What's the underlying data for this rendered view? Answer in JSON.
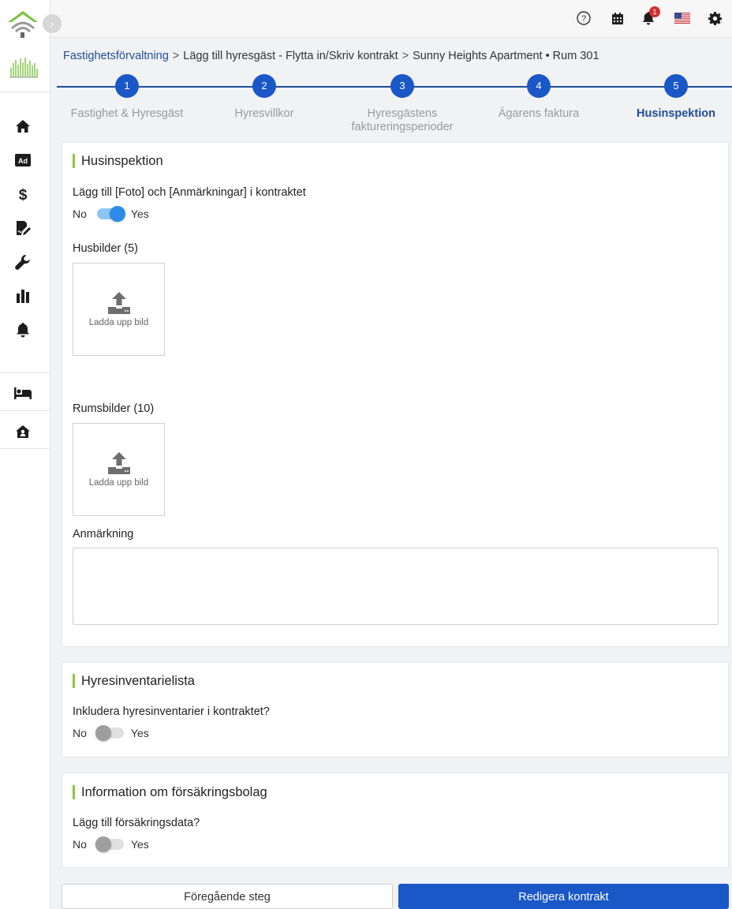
{
  "breadcrumb": {
    "root": "Fastighetsförvaltning",
    "separator": ">",
    "step": "Lägg till hyresgäst - Flytta in/Skriv kontrakt",
    "location": "Sunny Heights Apartment • Rum 301"
  },
  "topbar": {
    "help_icon": "help-circle-icon",
    "calendar_icon": "calendar-icon",
    "notification_icon": "bell-icon",
    "notification_count": "1",
    "language_icon": "us-flag-icon",
    "settings_icon": "gear-icon"
  },
  "sidebar": {
    "items": [
      {
        "icon": "home-icon"
      },
      {
        "icon": "ad-icon",
        "text": "Ad"
      },
      {
        "icon": "dollar-icon",
        "text": "$"
      },
      {
        "icon": "contract-sign-icon"
      },
      {
        "icon": "wrench-icon"
      },
      {
        "icon": "bar-chart-icon"
      },
      {
        "icon": "bell-icon"
      },
      {
        "icon": "bed-icon"
      },
      {
        "icon": "house-user-icon"
      }
    ]
  },
  "stepper": {
    "steps": [
      {
        "number": "1",
        "label": "Fastighet & Hyresgäst"
      },
      {
        "number": "2",
        "label": "Hyresvillkor"
      },
      {
        "number": "3",
        "label": "Hyresgästens faktureringsperioder"
      },
      {
        "number": "4",
        "label": "Ägarens faktura"
      },
      {
        "number": "5",
        "label": "Husinspektion"
      }
    ],
    "active_index": 4
  },
  "inspection": {
    "title": "Husinspektion",
    "question": "Lägg till [Foto] och [Anmärkningar] i kontraktet",
    "toggle_no": "No",
    "toggle_yes": "Yes",
    "toggle_on": true,
    "house_images_label": "Husbilder (5)",
    "room_images_label": "Rumsbilder (10)",
    "upload_text": "Ladda upp bild",
    "remark_label": "Anmärkning",
    "remark_value": ""
  },
  "inventory": {
    "title": "Hyresinventarielista",
    "question": "Inkludera hyresinventarier i kontraktet?",
    "toggle_no": "No",
    "toggle_yes": "Yes",
    "toggle_on": false
  },
  "insurance": {
    "title": "Information om försäkringsbolag",
    "question": "Lägg till försäkringsdata?",
    "toggle_no": "No",
    "toggle_yes": "Yes",
    "toggle_on": false
  },
  "footer": {
    "prev_label": "Föregående steg",
    "edit_label": "Redigera kontrakt"
  },
  "colors": {
    "primary": "#1a57c7",
    "link": "#1f4e96",
    "accent_bar": "#8dc63f",
    "toggle_on": "#2b8ce8",
    "badge": "#d32f2f"
  }
}
